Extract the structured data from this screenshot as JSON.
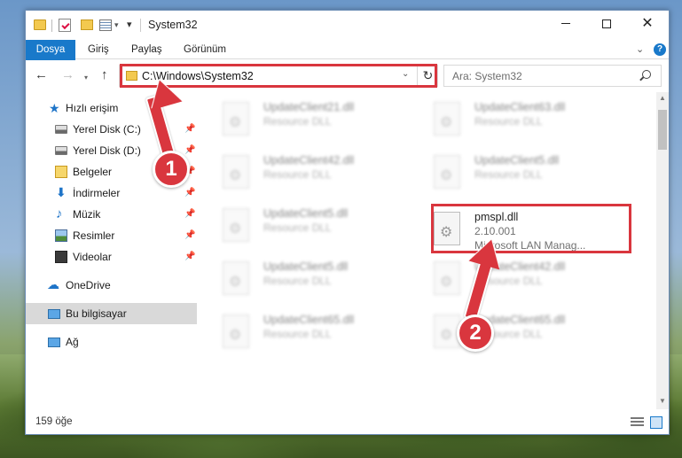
{
  "window": {
    "title": "System32"
  },
  "ribbon": {
    "tabs": [
      "Dosya",
      "Giriş",
      "Paylaş",
      "Görünüm"
    ],
    "help": "?"
  },
  "nav": {
    "address": "C:\\Windows\\System32",
    "search_placeholder": "Ara: System32"
  },
  "sidebar": {
    "items": [
      {
        "label": "Hızlı erişim",
        "icon": "star-icon"
      },
      {
        "label": "Yerel Disk (C:)",
        "icon": "disk-icon",
        "pinned": true
      },
      {
        "label": "Yerel Disk (D:)",
        "icon": "disk-icon",
        "pinned": true
      },
      {
        "label": "Belgeler",
        "icon": "documents-icon",
        "pinned": true
      },
      {
        "label": "İndirmeler",
        "icon": "download-icon",
        "pinned": true
      },
      {
        "label": "Müzik",
        "icon": "music-icon",
        "pinned": true
      },
      {
        "label": "Resimler",
        "icon": "pictures-icon",
        "pinned": true
      },
      {
        "label": "Videolar",
        "icon": "videos-icon",
        "pinned": true
      },
      {
        "label": "OneDrive",
        "icon": "onedrive-icon"
      },
      {
        "label": "Bu bilgisayar",
        "icon": "computer-icon",
        "selected": true
      },
      {
        "label": "Ağ",
        "icon": "network-icon"
      }
    ]
  },
  "files": [
    {
      "name": "UpdateClient21.dll",
      "desc": "Resource DLL",
      "blurred": true
    },
    {
      "name": "UpdateClient63.dll",
      "desc": "Resource DLL",
      "blurred": true
    },
    {
      "name": "UpdateClient42.dll",
      "desc": "Resource DLL",
      "blurred": true
    },
    {
      "name": "UpdateClient5.dll",
      "desc": "Resource DLL",
      "blurred": true
    },
    {
      "name": "UpdateClient5.dll",
      "desc": "Resource DLL",
      "blurred": true
    },
    {
      "name": "pmspl.dll",
      "version": "2.10.001",
      "desc": "Microsoft LAN Manag...",
      "blurred": false
    },
    {
      "name": "UpdateClient5.dll",
      "desc": "Resource DLL",
      "blurred": true
    },
    {
      "name": "UpdateClient42.dll",
      "desc": "Resource DLL",
      "blurred": true
    },
    {
      "name": "UpdateClient65.dll",
      "desc": "Resource DLL",
      "blurred": true
    },
    {
      "name": "UpdateClient65.dll",
      "desc": "Resource DLL",
      "blurred": true
    }
  ],
  "status": {
    "count": "159 öğe"
  },
  "annotations": {
    "step1": "1",
    "step2": "2",
    "color": "#d9363e"
  }
}
